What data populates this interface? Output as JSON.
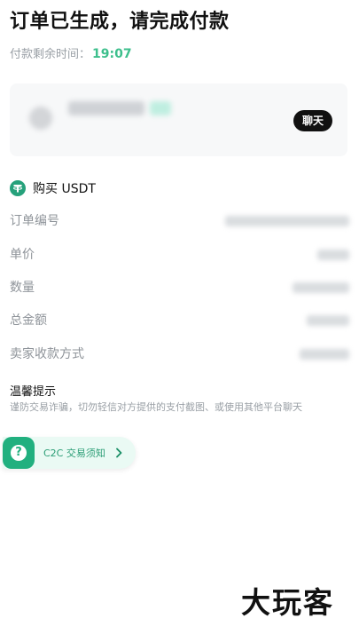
{
  "header": {
    "title": "订单已生成，请完成付款",
    "timer_label": "付款剩余时间：",
    "timer_value": "19:07"
  },
  "seller": {
    "chat_label": "聊天"
  },
  "order": {
    "buy_label": "购买 USDT",
    "rows": [
      {
        "label": "订单编号"
      },
      {
        "label": "单价"
      },
      {
        "label": "数量"
      },
      {
        "label": "总金额"
      },
      {
        "label": "卖家收款方式"
      }
    ]
  },
  "tips": {
    "title": "温馨提示",
    "text": "谨防交易诈骗，切勿轻信对方提供的支付截图、或使用其他平台聊天"
  },
  "notice": {
    "label": "C2C 交易须知"
  },
  "watermark": {
    "text": "大玩客"
  },
  "colors": {
    "accent_green": "#3dbf8c",
    "tether_green": "#26a17b",
    "chat_button": "#111111"
  },
  "icons": {
    "tether": "tether-icon",
    "notice": "question-icon",
    "chevron": "chevron-right-icon"
  }
}
